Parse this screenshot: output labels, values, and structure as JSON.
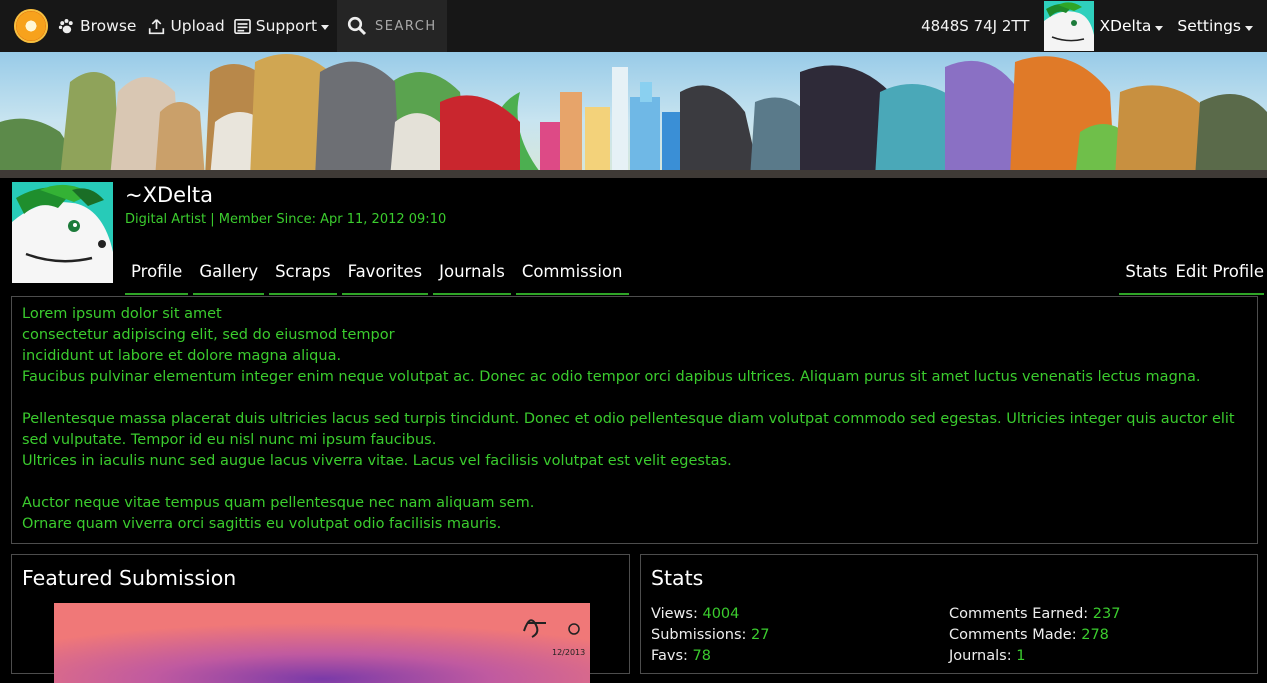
{
  "nav": {
    "browse": "Browse",
    "upload": "Upload",
    "support": "Support",
    "search_placeholder": "SEARCH",
    "user_code": "4848S 74J 2TT",
    "username": "XDelta",
    "settings": "Settings"
  },
  "profile": {
    "name": "~XDelta",
    "subtitle": "Digital Artist | Member Since: Apr 11, 2012 09:10",
    "tabs": [
      "Profile",
      "Gallery",
      "Scraps",
      "Favorites",
      "Journals",
      "Commission"
    ],
    "right_tabs": [
      "Stats",
      "Edit Profile"
    ]
  },
  "bio": {
    "paragraphs": [
      "Lorem ipsum dolor sit amet\nconsectetur adipiscing elit, sed do eiusmod tempor\nincididunt ut labore et dolore magna aliqua.\nFaucibus pulvinar elementum integer enim neque volutpat ac. Donec ac odio tempor orci dapibus ultrices. Aliquam purus sit amet luctus venenatis lectus magna.",
      "Pellentesque massa placerat duis ultricies lacus sed turpis tincidunt. Donec et odio pellentesque diam volutpat commodo sed egestas. Ultricies integer quis auctor elit sed vulputate. Tempor id eu nisl nunc mi ipsum faucibus.\nUltrices in iaculis nunc sed augue lacus viverra vitae. Lacus vel facilisis volutpat est velit egestas.",
      "Auctor neque vitae tempus quam pellentesque nec nam aliquam sem.\nOrnare quam viverra orci sagittis eu volutpat odio facilisis mauris."
    ]
  },
  "featured": {
    "title": "Featured Submission",
    "signature_date": "12/2013"
  },
  "stats": {
    "title": "Stats",
    "views_label": "Views:",
    "views": "4004",
    "submissions_label": "Submissions:",
    "submissions": "27",
    "favs_label": "Favs:",
    "favs": "78",
    "comments_earned_label": "Comments Earned:",
    "comments_earned": "237",
    "comments_made_label": "Comments Made:",
    "comments_made": "278",
    "journals_label": "Journals:",
    "journals": "1"
  },
  "colors": {
    "accent_green": "#3bcc2e",
    "navbar_bg": "#171717",
    "panel_border": "#4d4d4d"
  }
}
